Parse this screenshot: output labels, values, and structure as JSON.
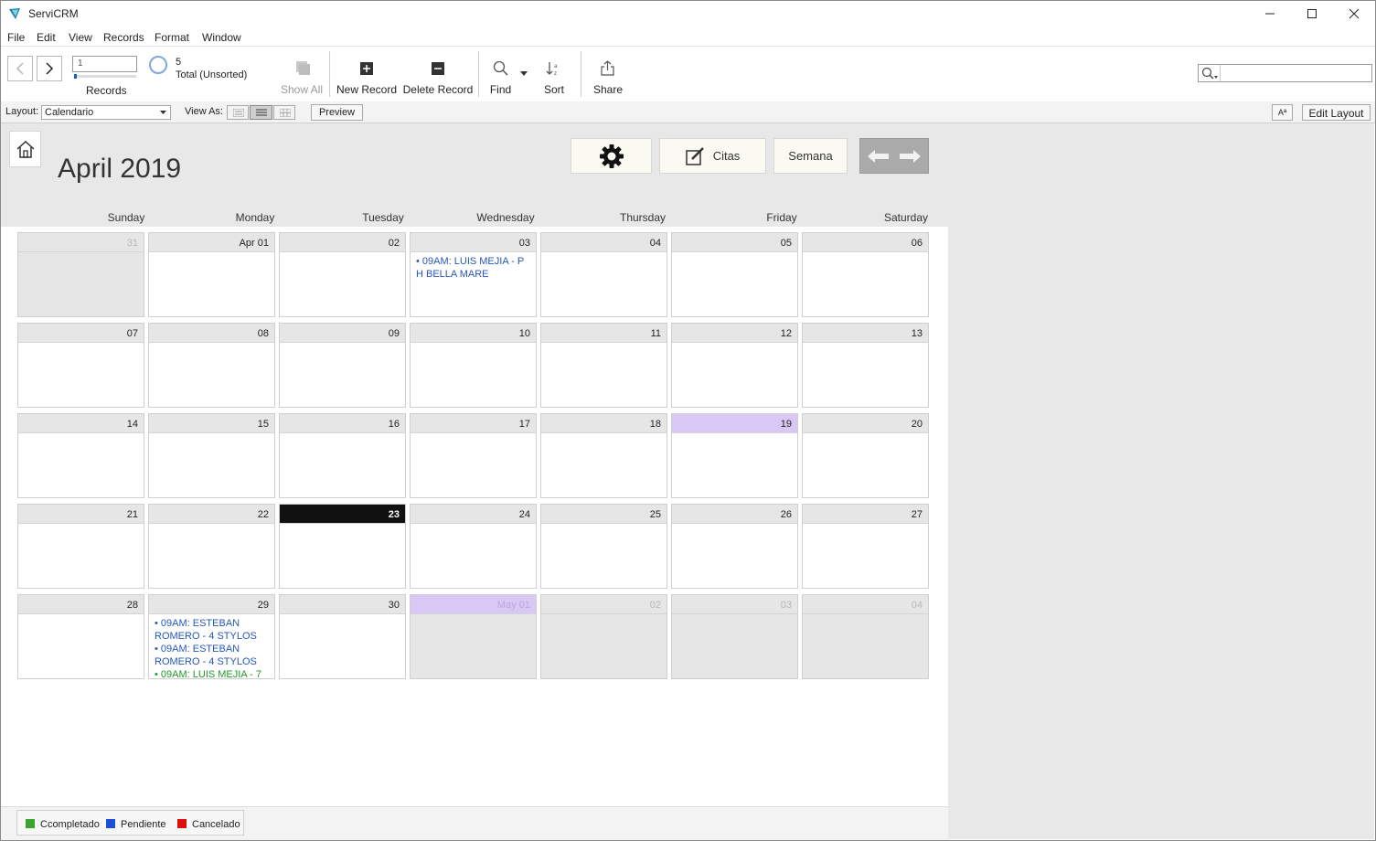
{
  "window": {
    "title": "ServiCRM"
  },
  "menu": [
    "File",
    "Edit",
    "View",
    "Records",
    "Format",
    "Window"
  ],
  "toolbar": {
    "record_input_value": "1",
    "records_label": "Records",
    "total_count": "5",
    "total_label": "Total (Unsorted)",
    "show_all": "Show All",
    "new_record": "New Record",
    "delete_record": "Delete Record",
    "find": "Find",
    "sort": "Sort",
    "share": "Share",
    "search_value": ""
  },
  "layoutbar": {
    "layout_label": "Layout:",
    "layout_value": "Calendario",
    "view_as_label": "View As:",
    "preview": "Preview",
    "font_btn": "Aª",
    "edit_layout": "Edit Layout"
  },
  "calendar": {
    "month_title": "April 2019",
    "buttons": {
      "citas": "Citas",
      "semana": "Semana"
    },
    "days_of_week": [
      "Sunday",
      "Monday",
      "Tuesday",
      "Wednesday",
      "Thursday",
      "Friday",
      "Saturday"
    ],
    "weeks": [
      [
        {
          "d": "31",
          "out": true
        },
        {
          "d": "Apr 01"
        },
        {
          "d": "02"
        },
        {
          "d": "03",
          "events": [
            {
              "text": "• 09AM: LUIS MEJIA - P H BELLA  MARE",
              "color": "blue"
            }
          ]
        },
        {
          "d": "04"
        },
        {
          "d": "05"
        },
        {
          "d": "06"
        }
      ],
      [
        {
          "d": "07"
        },
        {
          "d": "08"
        },
        {
          "d": "09"
        },
        {
          "d": "10"
        },
        {
          "d": "11"
        },
        {
          "d": "12"
        },
        {
          "d": "13"
        }
      ],
      [
        {
          "d": "14"
        },
        {
          "d": "15"
        },
        {
          "d": "16"
        },
        {
          "d": "17"
        },
        {
          "d": "18"
        },
        {
          "d": "19",
          "highlight": true
        },
        {
          "d": "20"
        }
      ],
      [
        {
          "d": "21"
        },
        {
          "d": "22"
        },
        {
          "d": "23",
          "today": true
        },
        {
          "d": "24"
        },
        {
          "d": "25"
        },
        {
          "d": "26"
        },
        {
          "d": "27"
        }
      ],
      [
        {
          "d": "28"
        },
        {
          "d": "29",
          "events": [
            {
              "text": "• 09AM: ESTEBAN ROMERO - 4 STYLOS",
              "color": "blue"
            },
            {
              "text": "• 09AM: ESTEBAN ROMERO - 4 STYLOS",
              "color": "blue"
            },
            {
              "text": "• 09AM: LUIS MEJIA - 7",
              "color": "green"
            }
          ]
        },
        {
          "d": "30"
        },
        {
          "d": "May 01",
          "out": true,
          "highlight": true
        },
        {
          "d": "02",
          "out": true
        },
        {
          "d": "03",
          "out": true
        },
        {
          "d": "04",
          "out": true
        }
      ]
    ]
  },
  "legend": [
    {
      "label": "Ccompletado",
      "color": "#3aa52e"
    },
    {
      "label": "Pendiente",
      "color": "#1f4fd6"
    },
    {
      "label": "Cancelado",
      "color": "#e01010"
    }
  ]
}
